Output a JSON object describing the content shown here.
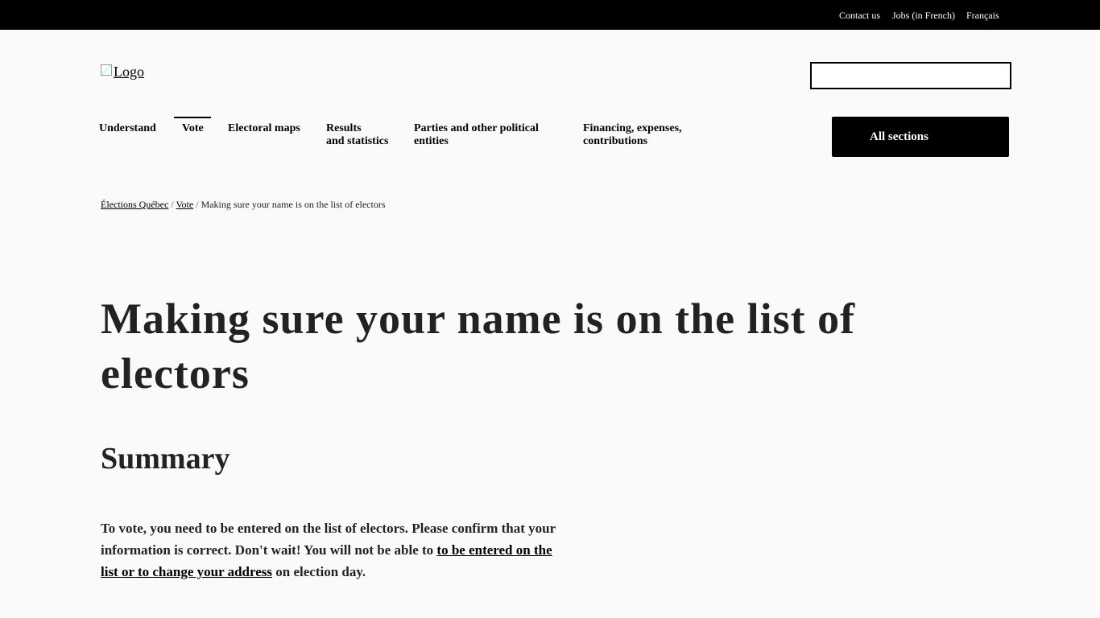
{
  "top_bar": {
    "links": [
      "Contact us",
      "Jobs (in French)",
      "Français"
    ]
  },
  "header": {
    "logo_alt": "Logo",
    "search": {
      "value": "",
      "placeholder": ""
    }
  },
  "nav": {
    "items": [
      {
        "label": "Understand"
      },
      {
        "label": "Vote",
        "active": true
      },
      {
        "label": "Electoral maps"
      },
      {
        "label": "Results",
        "label2": "and statistics"
      },
      {
        "label": "Parties and other political",
        "label2": "entities"
      },
      {
        "label": "Financing, expenses,",
        "label2": "contributions"
      }
    ],
    "all_sections": "All sections"
  },
  "breadcrumb": {
    "items": [
      "Élections Québec",
      "Vote"
    ],
    "separator": " / ",
    "current": "Making sure your name is on the list of electors"
  },
  "main": {
    "title": "Making sure your name is on the list of electors",
    "summary_heading": "Summary",
    "summary_text_before": "To vote, you need to be entered on the list of electors. Please confirm that your information is correct. Don't wait! You will not be able to ",
    "summary_link": "to be entered on the list or to change your address",
    "summary_text_after": " on election day."
  }
}
